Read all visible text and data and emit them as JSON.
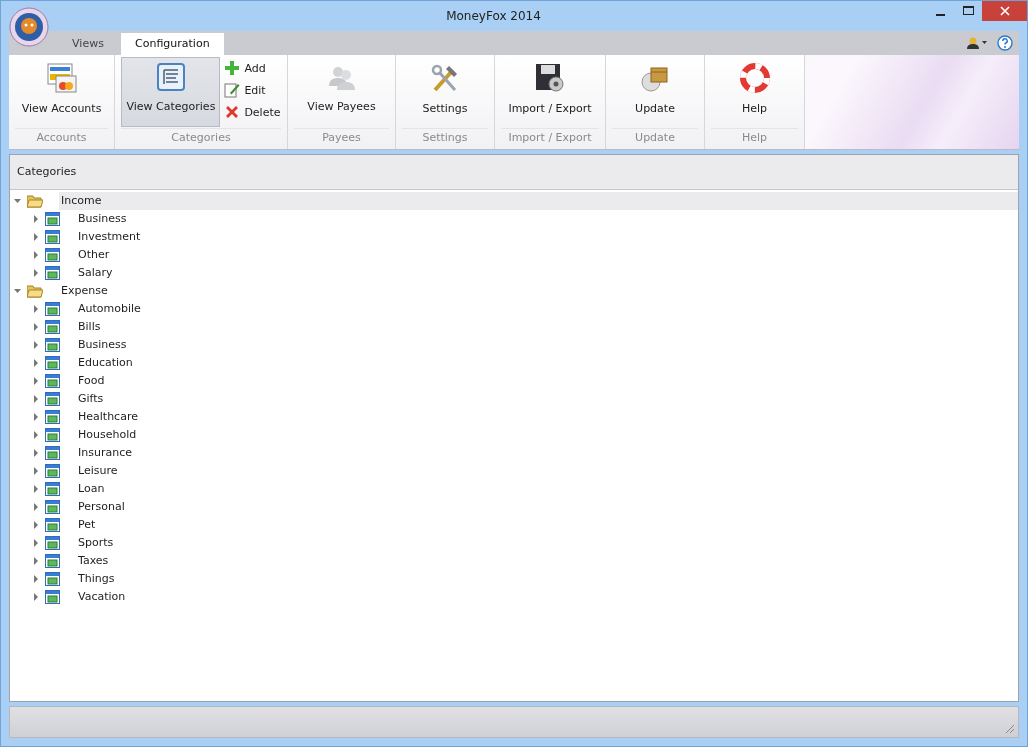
{
  "window": {
    "title": "MoneyFox 2014"
  },
  "tabs": [
    {
      "label": "Views",
      "selected": false
    },
    {
      "label": "Configuration",
      "selected": true
    }
  ],
  "ribbon_groups": [
    {
      "label": "Accounts",
      "buttons": [
        {
          "label": "View Accounts",
          "selected": false
        }
      ]
    },
    {
      "label": "Categories",
      "buttons": [
        {
          "label": "View Categories",
          "selected": true
        }
      ],
      "small_buttons": [
        {
          "label": "Add"
        },
        {
          "label": "Edit"
        },
        {
          "label": "Delete"
        }
      ]
    },
    {
      "label": "Payees",
      "buttons": [
        {
          "label": "View Payees",
          "selected": false
        }
      ]
    },
    {
      "label": "Settings",
      "buttons": [
        {
          "label": "Settings",
          "selected": false
        }
      ]
    },
    {
      "label": "Import / Export",
      "buttons": [
        {
          "label": "Import / Export",
          "selected": false
        }
      ]
    },
    {
      "label": "Update",
      "buttons": [
        {
          "label": "Update",
          "selected": false
        }
      ]
    },
    {
      "label": "Help",
      "buttons": [
        {
          "label": "Help",
          "selected": false
        }
      ]
    }
  ],
  "panel": {
    "title": "Categories"
  },
  "tree": [
    {
      "label": "Income",
      "expanded": true,
      "selected": true,
      "children": [
        {
          "label": "Business",
          "expanded": false,
          "selected": false
        },
        {
          "label": "Investment",
          "expanded": false,
          "selected": false
        },
        {
          "label": "Other",
          "expanded": false,
          "selected": false
        },
        {
          "label": "Salary",
          "expanded": false,
          "selected": false
        }
      ]
    },
    {
      "label": "Expense",
      "expanded": true,
      "selected": false,
      "children": [
        {
          "label": "Automobile",
          "expanded": false,
          "selected": false
        },
        {
          "label": "Bills",
          "expanded": false,
          "selected": false
        },
        {
          "label": "Business",
          "expanded": false,
          "selected": false
        },
        {
          "label": "Education",
          "expanded": false,
          "selected": false
        },
        {
          "label": "Food",
          "expanded": false,
          "selected": false
        },
        {
          "label": "Gifts",
          "expanded": false,
          "selected": false
        },
        {
          "label": "Healthcare",
          "expanded": false,
          "selected": false
        },
        {
          "label": "Household",
          "expanded": false,
          "selected": false
        },
        {
          "label": "Insurance",
          "expanded": false,
          "selected": false
        },
        {
          "label": "Leisure",
          "expanded": false,
          "selected": false
        },
        {
          "label": "Loan",
          "expanded": false,
          "selected": false
        },
        {
          "label": "Personal",
          "expanded": false,
          "selected": false
        },
        {
          "label": "Pet",
          "expanded": false,
          "selected": false
        },
        {
          "label": "Sports",
          "expanded": false,
          "selected": false
        },
        {
          "label": "Taxes",
          "expanded": false,
          "selected": false
        },
        {
          "label": "Things",
          "expanded": false,
          "selected": false
        },
        {
          "label": "Vacation",
          "expanded": false,
          "selected": false
        }
      ]
    }
  ]
}
